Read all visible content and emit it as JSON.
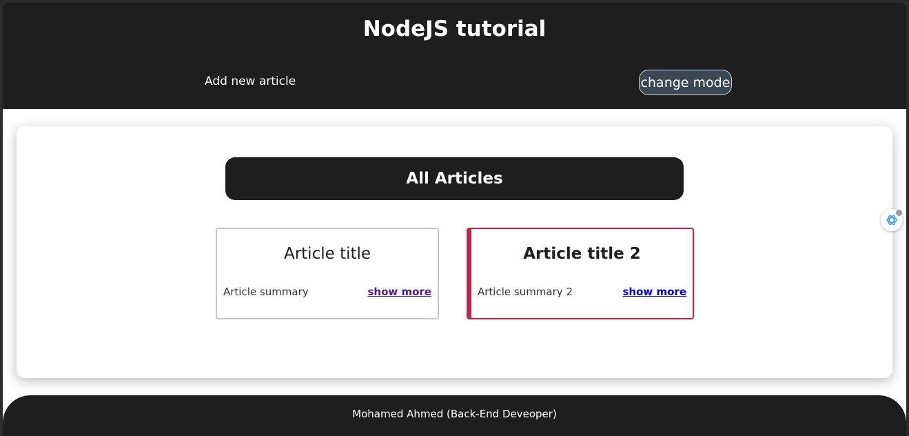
{
  "header": {
    "title": "NodeJS tutorial",
    "nav_add_article": "Add new article",
    "mode_button": "change mode"
  },
  "main": {
    "section_title": "All Articles",
    "articles": [
      {
        "title": "Article title",
        "summary": "Article summary",
        "link": "show more"
      },
      {
        "title": "Article title 2",
        "summary": "Article summary 2",
        "link": "show more"
      }
    ]
  },
  "footer": {
    "text": "Mohamed Ahmed (Back-End Deveoper)"
  },
  "icons": {
    "extension": "assistant-extension-icon"
  },
  "colors": {
    "header_bg": "#1e1e1e",
    "mode_button_bg": "#3c4756",
    "active_article_border": "#cc1f45",
    "visited_link": "#551a8b",
    "link": "#0000ee"
  }
}
